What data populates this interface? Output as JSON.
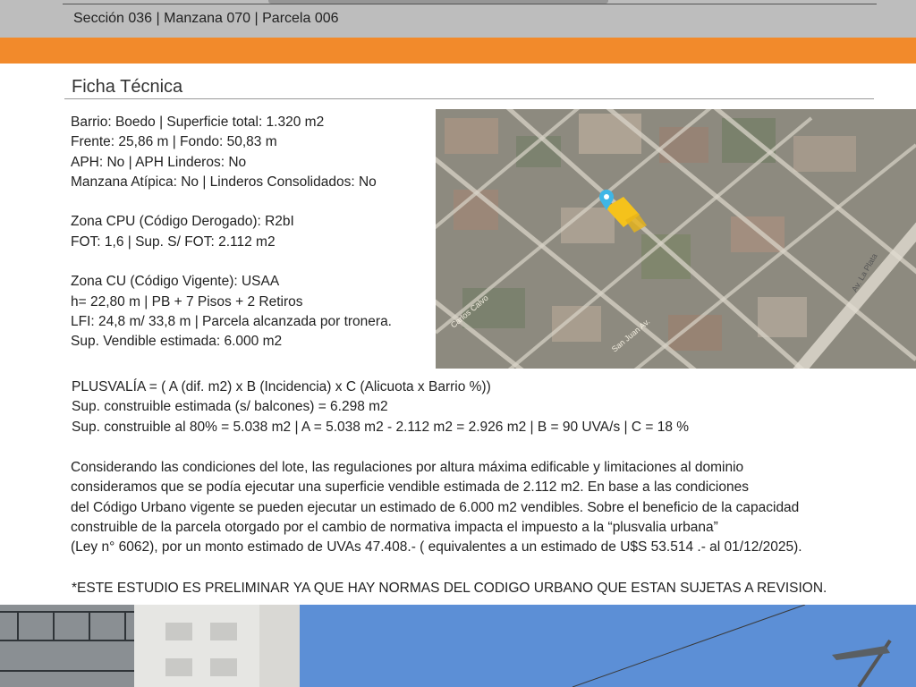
{
  "header": {
    "subtitle": "Sección 036 | Manzana  070 | Parcela 006"
  },
  "section": {
    "title": "Ficha Técnica"
  },
  "specs": {
    "group1": [
      "Barrio: Boedo | Superficie total:  1.320 m2",
      "Frente: 25,86 m | Fondo: 50,83 m",
      "APH: No  | APH Linderos: No",
      "Manzana Atípica: No  | Linderos Consolidados: No"
    ],
    "group2": [
      "Zona CPU (Código Derogado): R2bI",
      "FOT: 1,6 | Sup. S/ FOT: 2.112 m2"
    ],
    "group3": [
      "Zona CU (Código Vigente): USAA",
      "h= 22,80 m | PB + 7 Pisos + 2 Retiros",
      "LFI: 24,8 m/ 33,8 m | Parcela alcanzada por tronera.",
      "Sup. Vendible estimada:  6.000 m2"
    ]
  },
  "map": {
    "street_labels": [
      "Carlos Calvo",
      "San Juan Av.",
      "Av. La Plata"
    ],
    "pin_color": "#3fb6e6",
    "lot_color": "#f5c21b"
  },
  "formula": {
    "lines": [
      "PLUSVALÍA = ( A (dif. m2) x B (Incidencia) x C (Alicuota x Barrio %))",
      "Sup. construible estimada (s/ balcones) = 6.298 m2",
      "Sup. construible al 80% = 5.038 m2 |  A = 5.038 m2 - 2.112 m2 = 2.926 m2 | B = 90 UVA/s | C = 18 %"
    ]
  },
  "description": {
    "lines": [
      "Considerando las condiciones del lote, las regulaciones por altura máxima edificable y limitaciones al  dominio",
      "consideramos que se podía ejecutar una superficie vendible estimada de 2.112 m2.  En base a las condiciones",
      "del Código Urbano vigente se pueden ejecutar un estimado de 6.000 m2 vendibles. Sobre el beneficio de la capacidad",
      "construible de la parcela otorgado por el cambio de normativa impacta el impuesto a la “plusvalia urbana”",
      "(Ley n° 6062), por un monto estimado de UVAs 47.408.- ( equivalentes a un estimado de U$S 53.514 .- al 01/12/2025)."
    ]
  },
  "disclaimer": "*ESTE ESTUDIO ES PRELIMINAR YA QUE HAY NORMAS DEL CODIGO URBANO QUE ESTAN SUJETAS A REVISION.",
  "colors": {
    "header_gray": "#bdbdbd",
    "accent_orange": "#f28a2b"
  }
}
